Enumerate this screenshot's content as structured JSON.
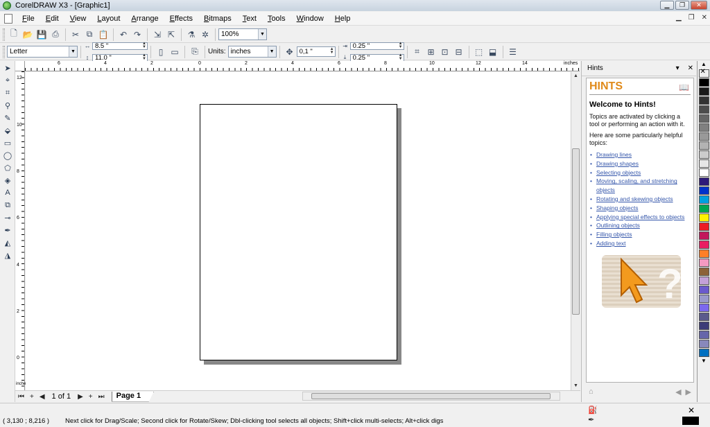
{
  "window": {
    "title": "CorelDRAW X3 - [Graphic1]"
  },
  "menu": [
    "File",
    "Edit",
    "View",
    "Layout",
    "Arrange",
    "Effects",
    "Bitmaps",
    "Text",
    "Tools",
    "Window",
    "Help"
  ],
  "toolbar1": {
    "zoom": "100%"
  },
  "toolbar2": {
    "paper_size": "Letter",
    "width": "8.5 \"",
    "height": "11.0 \"",
    "units_label": "Units:",
    "units_value": "inches",
    "nudge": "0,1 \"",
    "dup_x": "0.25 \"",
    "dup_y": "0.25 \""
  },
  "rulers": {
    "unit": "inches",
    "top_ticks": [
      "6",
      "4",
      "2",
      "0",
      "2",
      "4",
      "6",
      "8",
      "10",
      "12",
      "14"
    ],
    "left_ticks": [
      "12",
      "10",
      "8",
      "6",
      "4",
      "2",
      "0"
    ],
    "left_unit": "inches"
  },
  "pagebar": {
    "count": "1 of 1",
    "tab": "Page 1"
  },
  "docker": {
    "header": "Hints",
    "title": "HINTS",
    "welcome": "Welcome to Hints!",
    "p1": "Topics are activated by clicking a tool or performing an action with it.",
    "p2": "Here are some particularly helpful topics:",
    "links": [
      "Drawing lines",
      "Drawing shapes",
      "Selecting objects",
      "Moving, scaling, and stretching objects",
      "Rotating and skewing objects",
      "Shaping objects",
      "Applying special effects to objects",
      "Outlining objects",
      "Filling objects",
      "Adding text"
    ]
  },
  "palette": [
    "#ffffff",
    "#000000",
    "#1a1a1a",
    "#333333",
    "#4d4d4d",
    "#666666",
    "#808080",
    "#999999",
    "#b3b3b3",
    "#cccccc",
    "#e6e6e6",
    "#ffffff",
    "#2e1a7a",
    "#0033cc",
    "#00a0e0",
    "#00a651",
    "#fff200",
    "#ed1c24",
    "#c2185b",
    "#e91e63",
    "#ff7f27",
    "#f49ac1",
    "#8c6239",
    "#c3a0d8",
    "#6a5acd",
    "#9999cc",
    "#7b68ee",
    "#5a5a8c",
    "#3c3c78",
    "#6666aa",
    "#8888bb",
    "#0070c0"
  ],
  "status": {
    "coords": "( 3,130 ; 8,216 )",
    "message": "Next click for Drag/Scale; Second click for Rotate/Skew; Dbl-clicking tool selects all objects; Shift+click multi-selects; Alt+click digs"
  }
}
